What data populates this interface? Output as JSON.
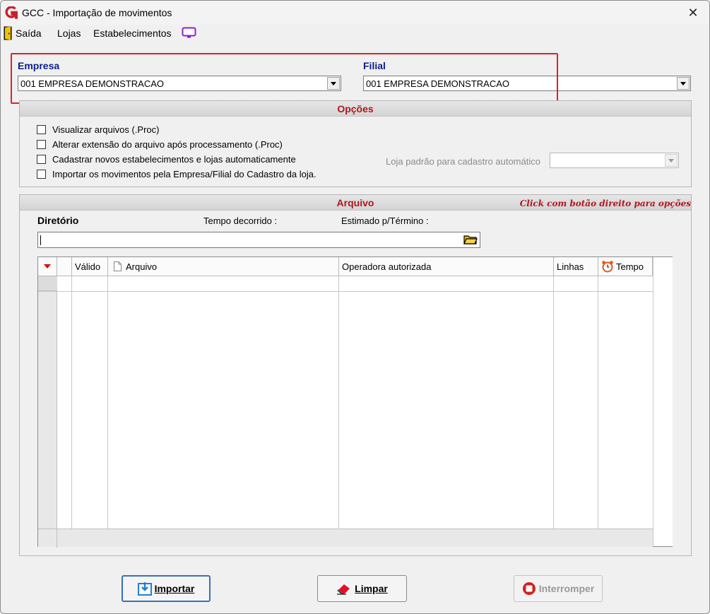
{
  "window": {
    "title": "GCC - Importação de movimentos",
    "close_glyph": "✕"
  },
  "menu": {
    "items": [
      {
        "label": "Saída",
        "icon": "exit-door-icon"
      },
      {
        "label": "Lojas"
      },
      {
        "label": "Estabelecimentos"
      }
    ],
    "extra_icon": "monitor-icon"
  },
  "empresa": {
    "label": "Empresa",
    "value": "001 EMPRESA DEMONSTRACAO"
  },
  "filial": {
    "label": "Filial",
    "value": "001 EMPRESA DEMONSTRACAO"
  },
  "opcoes": {
    "title": "Opções",
    "checkboxes": [
      {
        "label": "Visualizar arquivos (.Proc)",
        "checked": false
      },
      {
        "label": "Alterar extensão do arquivo após processamento (.Proc)",
        "checked": false
      },
      {
        "label": "Cadastrar novos estabelecimentos e lojas automaticamente",
        "checked": false
      },
      {
        "label": "Importar os movimentos pela Empresa/Filial do Cadastro da loja.",
        "checked": false
      }
    ],
    "loja_padrao_label": "Loja padrão para cadastro automático",
    "loja_padrao_value": ""
  },
  "arquivo": {
    "title": "Arquivo",
    "hint": "Click com botão direito para opções",
    "diretorio_label": "Diretório",
    "tempo_label": "Tempo decorrido :",
    "estimado_label": "Estimado p/Término :",
    "diretorio_value": "",
    "columns": [
      "Válido",
      "Arquivo",
      "Operadora autorizada",
      "Linhas",
      "Tempo"
    ]
  },
  "buttons": {
    "importar": "Importar",
    "limpar": "Limpar",
    "interromper": "Interromper"
  },
  "colors": {
    "label_blue": "#0b1f8c",
    "group_red": "#b0161c",
    "highlight_red": "#d9232a"
  }
}
